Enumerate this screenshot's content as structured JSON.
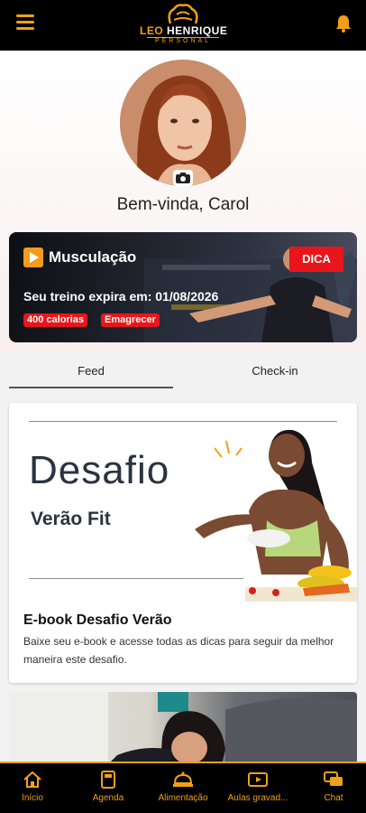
{
  "header": {
    "logo_name_first": "LEO",
    "logo_name_second": " HENRIQUE",
    "logo_tagline": "PERSONAL"
  },
  "profile": {
    "welcome": "Bem-vinda, Carol"
  },
  "promo": {
    "title": "Musculação",
    "expiry": "Seu treino expira em: 01/08/2026",
    "tags": [
      "400 calorias",
      "Emagrecer"
    ],
    "badge": "DICA"
  },
  "tabs": [
    "Feed",
    "Check-in"
  ],
  "feed": [
    {
      "banner_title": "Desafio",
      "banner_subtitle": "Verão Fit",
      "title": "E-book Desafio Verão",
      "text": "Baixe seu e-book e acesse todas as dicas para seguir da melhor maneira este desafio."
    }
  ],
  "bottom_nav": [
    {
      "label": "Início",
      "icon": "home-icon"
    },
    {
      "label": "Agenda",
      "icon": "agenda-icon"
    },
    {
      "label": "Alimentação",
      "icon": "food-icon"
    },
    {
      "label": "Aulas gravad...",
      "icon": "video-icon"
    },
    {
      "label": "Chat",
      "icon": "chat-icon"
    }
  ],
  "colors": {
    "accent": "#f0a018",
    "tag_red": "#e8161b",
    "bar_bg": "#000000"
  }
}
